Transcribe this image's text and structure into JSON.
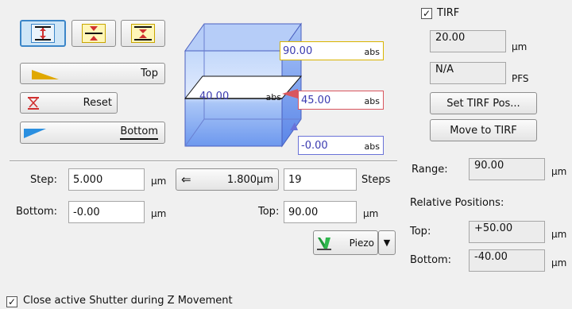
{
  "mode_buttons": [
    {
      "name": "range-mode",
      "active": true
    },
    {
      "name": "center-mode",
      "active": false
    },
    {
      "name": "symmetric-mode",
      "active": false
    }
  ],
  "top_button_label": "Top",
  "reset_button_label": "Reset",
  "bottom_button_label": "Bottom",
  "cube": {
    "top_value": "90.00",
    "top_unit": "abs",
    "current_value": "40.00",
    "current_unit": "abs",
    "home_value": "45.00",
    "home_unit": "abs",
    "bottom_value": "-0.00",
    "bottom_unit": "abs"
  },
  "tirf": {
    "label": "TIRF",
    "checked": true,
    "offset_value": "20.00",
    "offset_unit": "µm",
    "pfs_value": "N/A",
    "pfs_unit": "PFS",
    "set_button": "Set TIRF Pos...",
    "move_button": "Move to TIRF"
  },
  "step": {
    "label": "Step:",
    "value": "5.000",
    "unit": "µm",
    "size_button": "1.800µm",
    "steps_value": "19",
    "steps_label": "Steps"
  },
  "bottom": {
    "label": "Bottom:",
    "value": "-0.00",
    "unit": "µm"
  },
  "top": {
    "label": "Top:",
    "value": "90.00",
    "unit": "µm"
  },
  "piezo": {
    "label": "Piezo"
  },
  "range": {
    "label": "Range:",
    "value": "90.00",
    "unit": "µm"
  },
  "relative": {
    "heading": "Relative Positions:",
    "top_label": "Top:",
    "top_value": "+50.00",
    "top_unit": "µm",
    "bottom_label": "Bottom:",
    "bottom_value": "-40.00",
    "bottom_unit": "µm"
  },
  "shutter": {
    "label": "Close active Shutter during Z Movement",
    "checked": true
  },
  "colors": {
    "accent_yellow": "#d9b400",
    "accent_red": "#d9565e",
    "accent_blue": "#6a72d8",
    "cube_blue": "#7fa6f5"
  },
  "icons": {
    "top_marker": "yellow-triangle",
    "bottom_marker": "blue-triangle",
    "reset": "red-hourglass",
    "step_size_arrow": "left-arrow",
    "piezo": "green-triangle",
    "dropdown": "down-triangle"
  }
}
